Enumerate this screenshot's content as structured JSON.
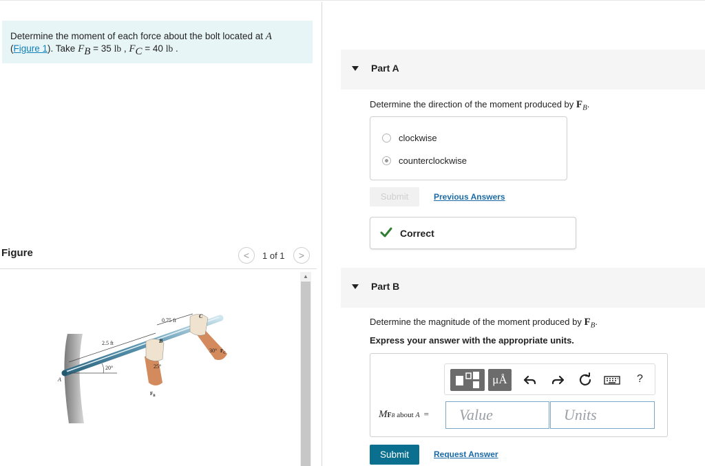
{
  "problem": {
    "text_before": "Determine the moment of each force about the bolt located at ",
    "point": "A",
    "link_text": "Figure 1",
    "text_take": "). Take ",
    "fb_sub": "B",
    "fb_value": " = 35 ",
    "fc_sub": "C",
    "fc_value": " = 40 ",
    "unit": "lb"
  },
  "figure": {
    "title": "Figure",
    "page_count": "1 of 1",
    "prev_icon": "chevron-left-icon",
    "next_icon": "chevron-right-icon",
    "labels": {
      "dist_2_5": "2.5 ft",
      "dist_0_75": "0.75 ft",
      "angle_20": "20°",
      "angle_25": "25°",
      "angle_30": "30°",
      "point_a": "A",
      "point_b": "B",
      "point_c": "C",
      "force_b": "F",
      "force_b_sub": "B",
      "force_c": "F",
      "force_c_sub": "C"
    }
  },
  "part_a": {
    "label": "Part A",
    "prompt": "Determine the direction of the moment produced by ",
    "vector": "F",
    "vector_sub": "B",
    "choices": [
      "clockwise",
      "counterclockwise"
    ],
    "selected_index": 1,
    "submit_label": "Submit",
    "previous_answers_label": "Previous Answers",
    "feedback": "Correct",
    "feedback_color": "#2e7d32"
  },
  "part_b": {
    "label": "Part B",
    "prompt": "Determine the magnitude of the moment produced by ",
    "vector": "F",
    "vector_sub": "B",
    "instruction": "Express your answer with the appropriate units.",
    "answer_label_main": "M",
    "answer_label_vec": "F",
    "answer_label_sub": "B",
    "answer_label_about": " about ",
    "answer_label_point": "A",
    "answer_label_eq": "=",
    "value_placeholder": "Value",
    "units_placeholder": "Units",
    "mu_label": "μÅ",
    "help_label": "?",
    "toolbar_icons": [
      "templates-icon",
      "units-mu-angstrom-icon",
      "undo-icon",
      "redo-icon",
      "reset-icon",
      "keyboard-icon",
      "help-icon"
    ],
    "submit_label": "Submit",
    "request_answer_label": "Request Answer"
  },
  "colors": {
    "accent": "#0b6f8f",
    "link": "#1a6aa8",
    "problem_bg": "#e8f5f7"
  }
}
